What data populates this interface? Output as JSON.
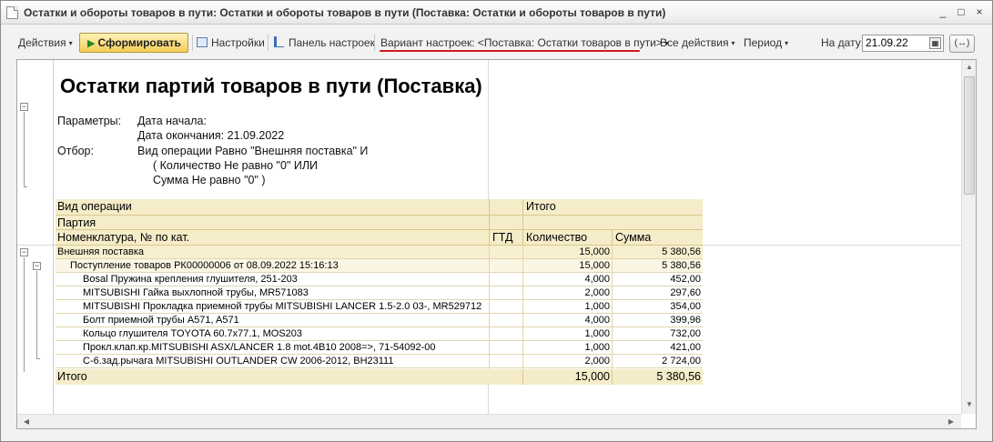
{
  "window": {
    "title": "Остатки и обороты товаров в пути: Остатки и обороты товаров в пути (Поставка: Остатки и обороты товаров в пути)",
    "min_glyph": "_",
    "max_glyph": "□",
    "close_glyph": "×"
  },
  "toolbar": {
    "actions": "Действия",
    "generate": "Сформировать",
    "settings": "Настройки",
    "settings_panel": "Панель настроек",
    "variant": "Вариант настроек: <Поставка: Остатки товаров в пути>",
    "all_actions": "Все действия",
    "period": "Период",
    "date_label": "На дату:",
    "date_value": "21.09.22",
    "period_btn": "(↔)"
  },
  "report": {
    "title": "Остатки партий товаров в пути (Поставка)",
    "params_label": "Параметры:",
    "param_start": "Дата начала:",
    "param_end": "Дата окончания: 21.09.2022",
    "filter_label": "Отбор:",
    "filter_1": "Вид операции Равно \"Внешняя поставка\" И",
    "filter_2": "( Количество Не равно \"0\" ИЛИ",
    "filter_3": "Сумма Не равно \"0\" )"
  },
  "table": {
    "headers": {
      "op_type": "Вид операции",
      "total": "Итого",
      "batch": "Партия",
      "nomenclature": "Номенклатура, № по кат.",
      "gtd": "ГТД",
      "qty": "Количество",
      "sum": "Сумма"
    },
    "rows": [
      {
        "name": "Внешняя поставка",
        "qty": "15,000",
        "sum": "5 380,56"
      },
      {
        "name": "Поступление товаров РК00000006 от 08.09.2022 15:16:13",
        "qty": "15,000",
        "sum": "5 380,56"
      },
      {
        "name": "Bosal Пружина крепления глушителя, 251-203",
        "qty": "4,000",
        "sum": "452,00"
      },
      {
        "name": "MITSUBISHI Гайка выхлопной трубы, MR571083",
        "qty": "2,000",
        "sum": "297,60"
      },
      {
        "name": "MITSUBISHI Прокладка приемной трубы MITSUBISHI LANCER 1.5-2.0 03-, MR529712",
        "qty": "1,000",
        "sum": "354,00"
      },
      {
        "name": "Болт приемной трубы A571, A571",
        "qty": "4,000",
        "sum": "399,96"
      },
      {
        "name": "Кольцо глушителя TOYOTA 60.7x77.1, MOS203",
        "qty": "1,000",
        "sum": "732,00"
      },
      {
        "name": "Прокл.клап.кр.MITSUBISHI ASX/LANCER 1.8 mot.4B10 2008=>, 71-54092-00",
        "qty": "1,000",
        "sum": "421,00"
      },
      {
        "name": "С-6.зад.рычага MITSUBISHI OUTLANDER CW 2006-2012, BH23111",
        "qty": "2,000",
        "sum": "2 724,00"
      }
    ],
    "total": {
      "label": "Итого",
      "qty": "15,000",
      "sum": "5 380,56"
    }
  },
  "icons": {
    "collapse": "−",
    "scroll_up": "▲",
    "scroll_down": "▼",
    "scroll_left": "◀",
    "scroll_right": "▶",
    "dropdown": "▾",
    "play": "▶",
    "calendar": "▦"
  },
  "colors": {
    "header_bg": "#f5ecc9",
    "generate_btn": "#f3cd57",
    "accent_underline": "#d61818"
  }
}
